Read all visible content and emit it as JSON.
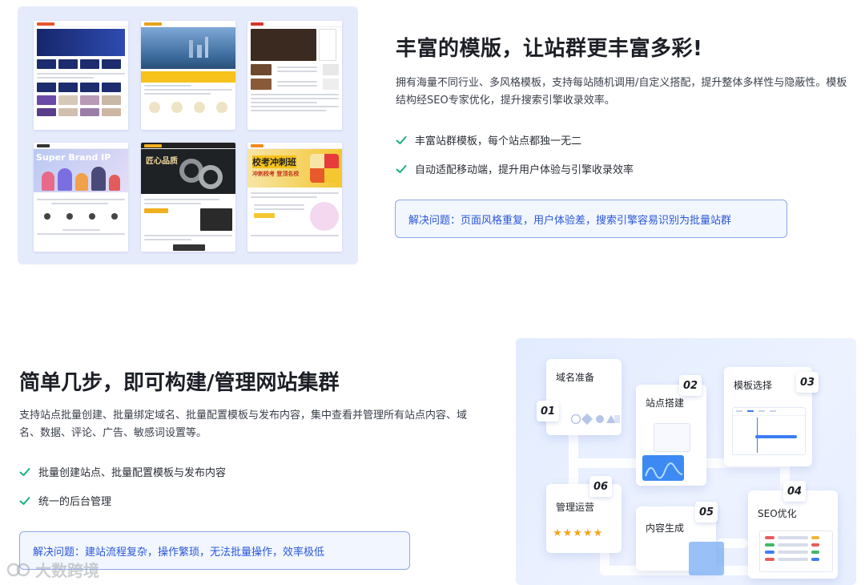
{
  "section1": {
    "title": "丰富的模版，让站群更丰富多彩!",
    "description": "拥有海量不同行业、多风格模板，支持每站随机调用/自定义搭配，提升整体多样性与隐蔽性。模板结构经SEO专家优化，提升搜索引擎收录效率。",
    "features": [
      "丰富站群模板，每个站点都独一无二",
      "自动适配移动端，提升用户体验与引擎收录效率"
    ],
    "solve_text": "解决问题：页面风格重复，用户体验差，搜索引擎容易识别为批量站群",
    "thumbnails": {
      "card1_banner": "Super Brand IP",
      "card2_heading": "匠心品质",
      "card3_heading": "校考冲刺班",
      "card3_sub": "冲刺校考 登顶名校"
    }
  },
  "section2": {
    "title": "简单几步，即可构建/管理网站集群",
    "description": "支持站点批量创建、批量绑定域名、批量配置模板与发布内容，集中查看并管理所有站点内容、域名、数据、评论、广告、敏感词设置等。",
    "features": [
      "批量创建站点、批量配置模板与发布内容",
      "统一的后台管理"
    ],
    "solve_text": "解决问题：建站流程复杂，操作繁琐，无法批量操作，效率极低",
    "steps": [
      {
        "num": "01",
        "label": "域名准备"
      },
      {
        "num": "02",
        "label": "站点搭建"
      },
      {
        "num": "03",
        "label": "模板选择"
      },
      {
        "num": "04",
        "label": "SEO优化"
      },
      {
        "num": "05",
        "label": "内容生成"
      },
      {
        "num": "06",
        "label": "管理运营"
      }
    ],
    "rating_stars": "★★★★★"
  },
  "colors": {
    "accent": "#2a57d8",
    "check": "#19b07a",
    "panel_bg": "#e5ebfb"
  },
  "watermark": "大数跨境"
}
